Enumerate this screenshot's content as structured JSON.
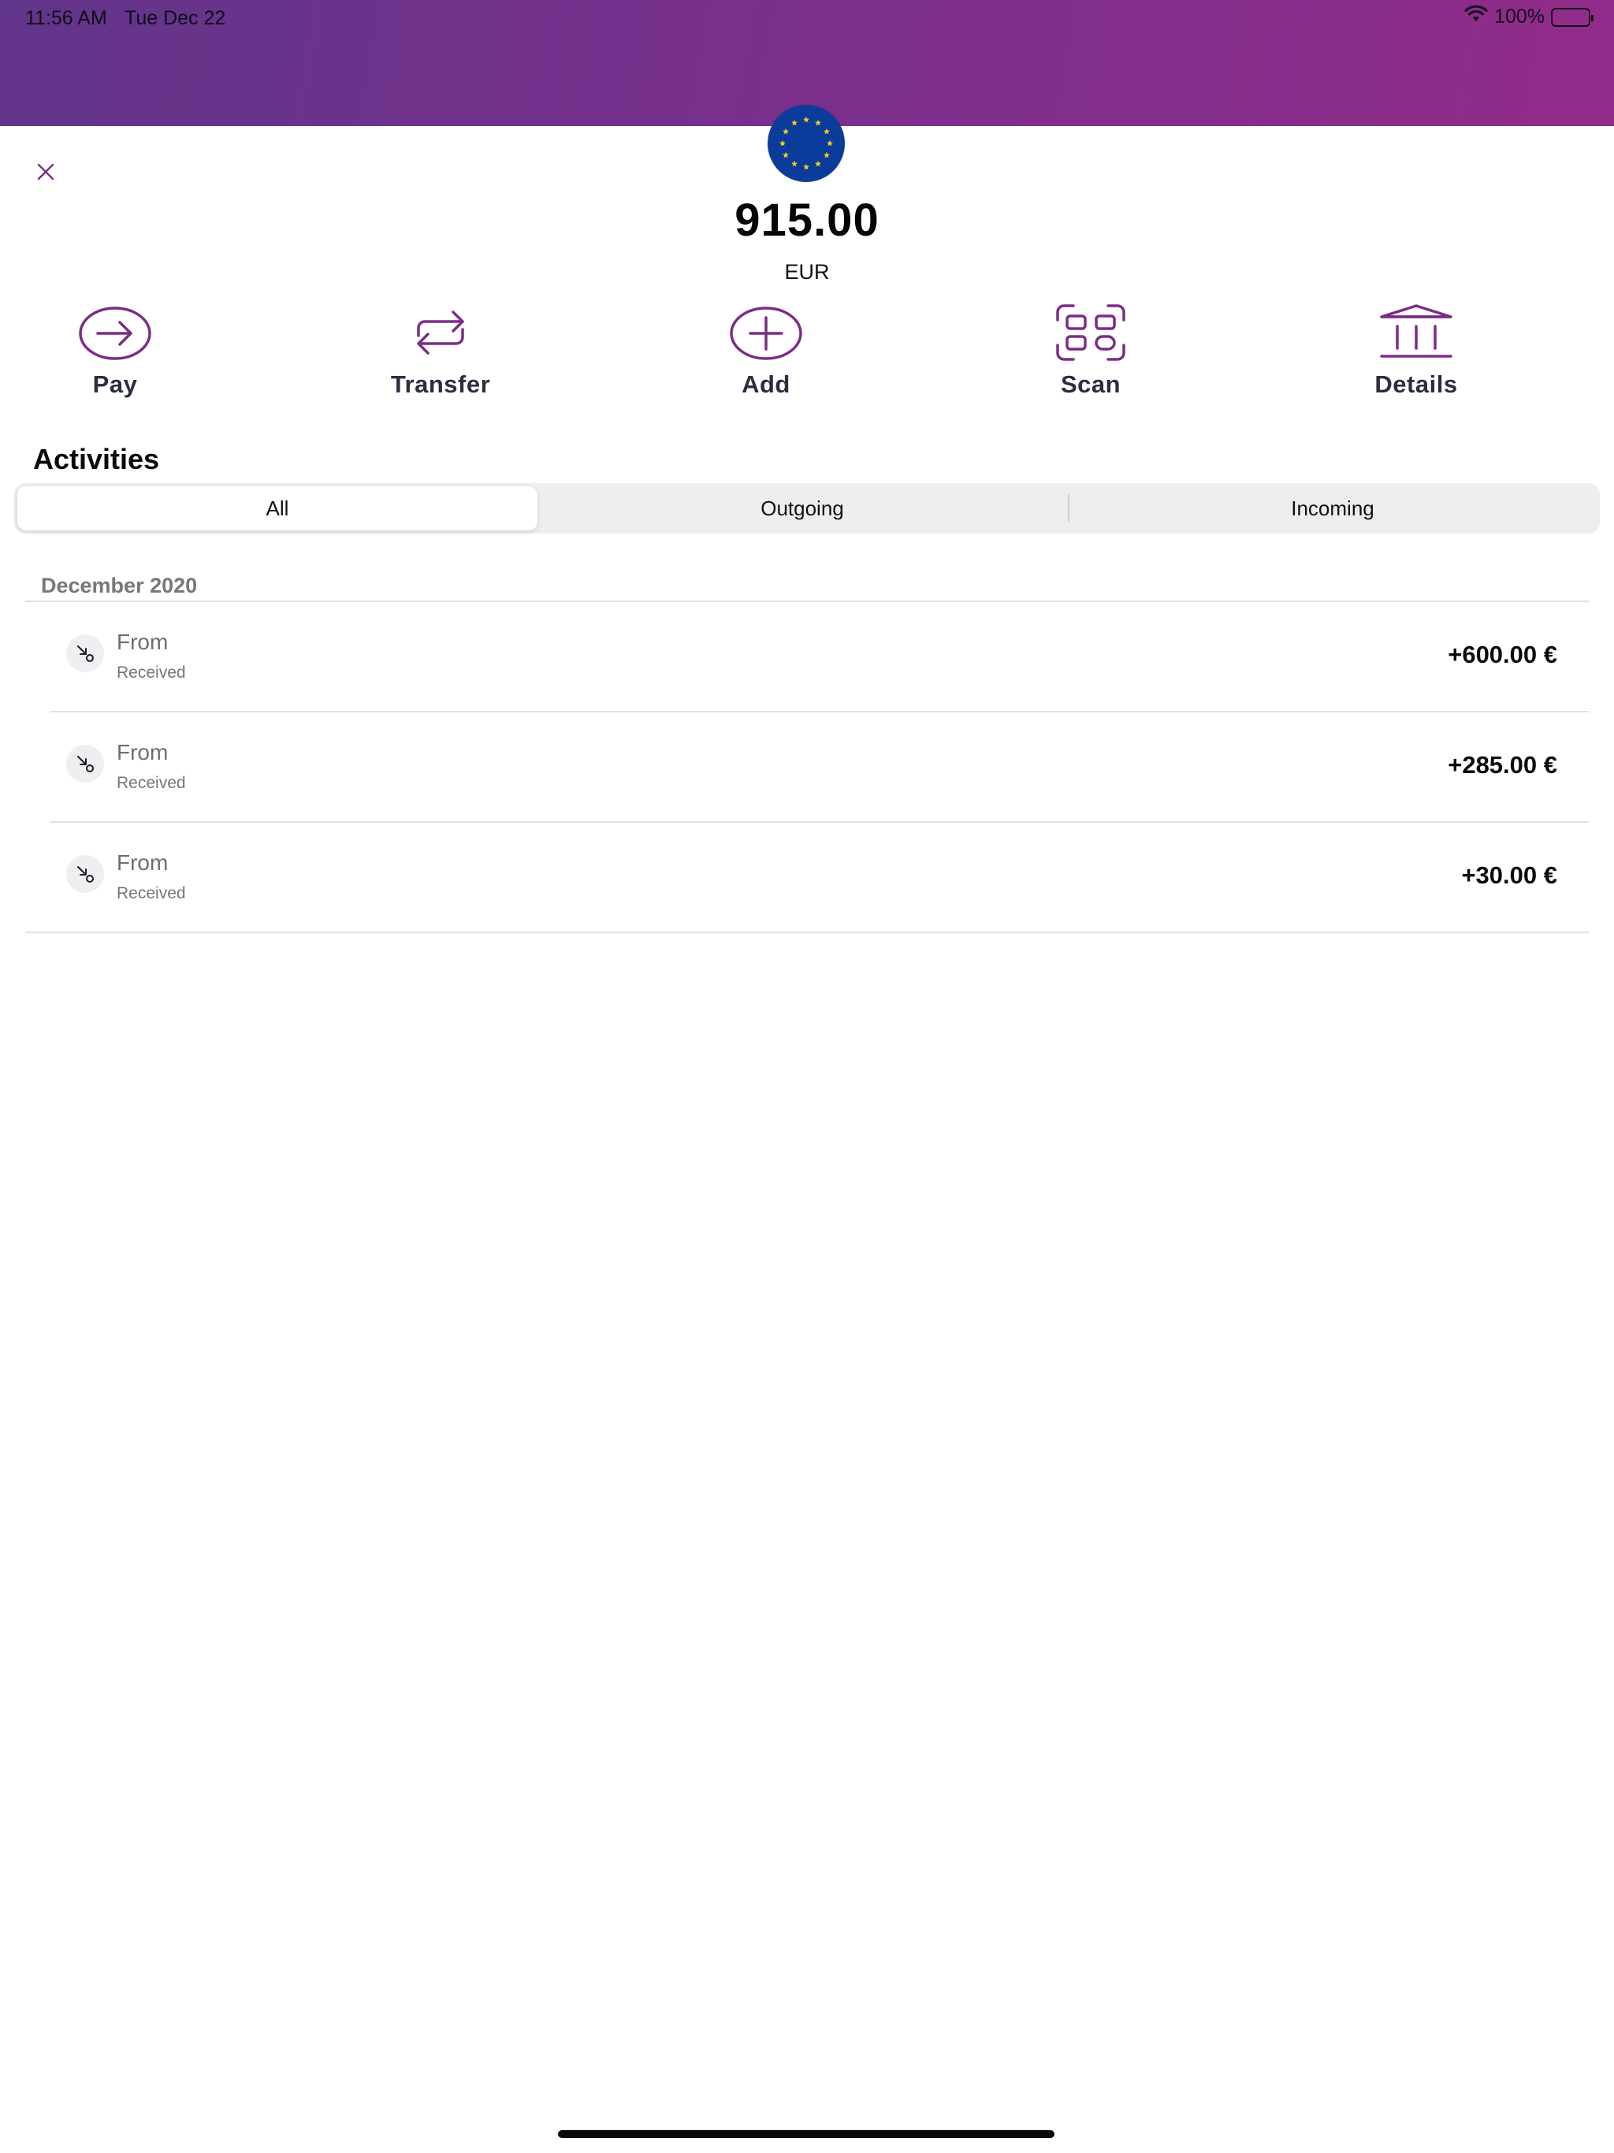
{
  "status_bar": {
    "time": "11:56 AM",
    "date": "Tue Dec 22",
    "battery_text": "100%",
    "icons": [
      "wifi-icon",
      "battery-icon"
    ]
  },
  "account": {
    "flag": "eu-flag-icon",
    "balance": "915.00",
    "currency": "EUR"
  },
  "actions": [
    {
      "label": "Pay",
      "icon": "arrow-right-circle-icon"
    },
    {
      "label": "Transfer",
      "icon": "transfer-arrows-icon"
    },
    {
      "label": "Add",
      "icon": "plus-circle-icon"
    },
    {
      "label": "Scan",
      "icon": "scan-grid-icon"
    },
    {
      "label": "Details",
      "icon": "bank-icon"
    }
  ],
  "activities": {
    "title": "Activities",
    "tabs": [
      {
        "label": "All",
        "selected": true
      },
      {
        "label": "Outgoing",
        "selected": false
      },
      {
        "label": "Incoming",
        "selected": false
      }
    ],
    "sections": [
      {
        "header": "December 2020",
        "items": [
          {
            "title": "From",
            "subtitle": "Received",
            "amount": "+600.00 €"
          },
          {
            "title": "From",
            "subtitle": "Received",
            "amount": "+285.00 €"
          },
          {
            "title": "From",
            "subtitle": "Received",
            "amount": "+30.00 €"
          }
        ]
      }
    ]
  },
  "colors": {
    "accent": "#7b2d86",
    "header_gradient_start": "#61358a",
    "header_gradient_end": "#922c8a",
    "flag_blue": "#0b3c9b",
    "flag_star": "#f4cf1a"
  }
}
